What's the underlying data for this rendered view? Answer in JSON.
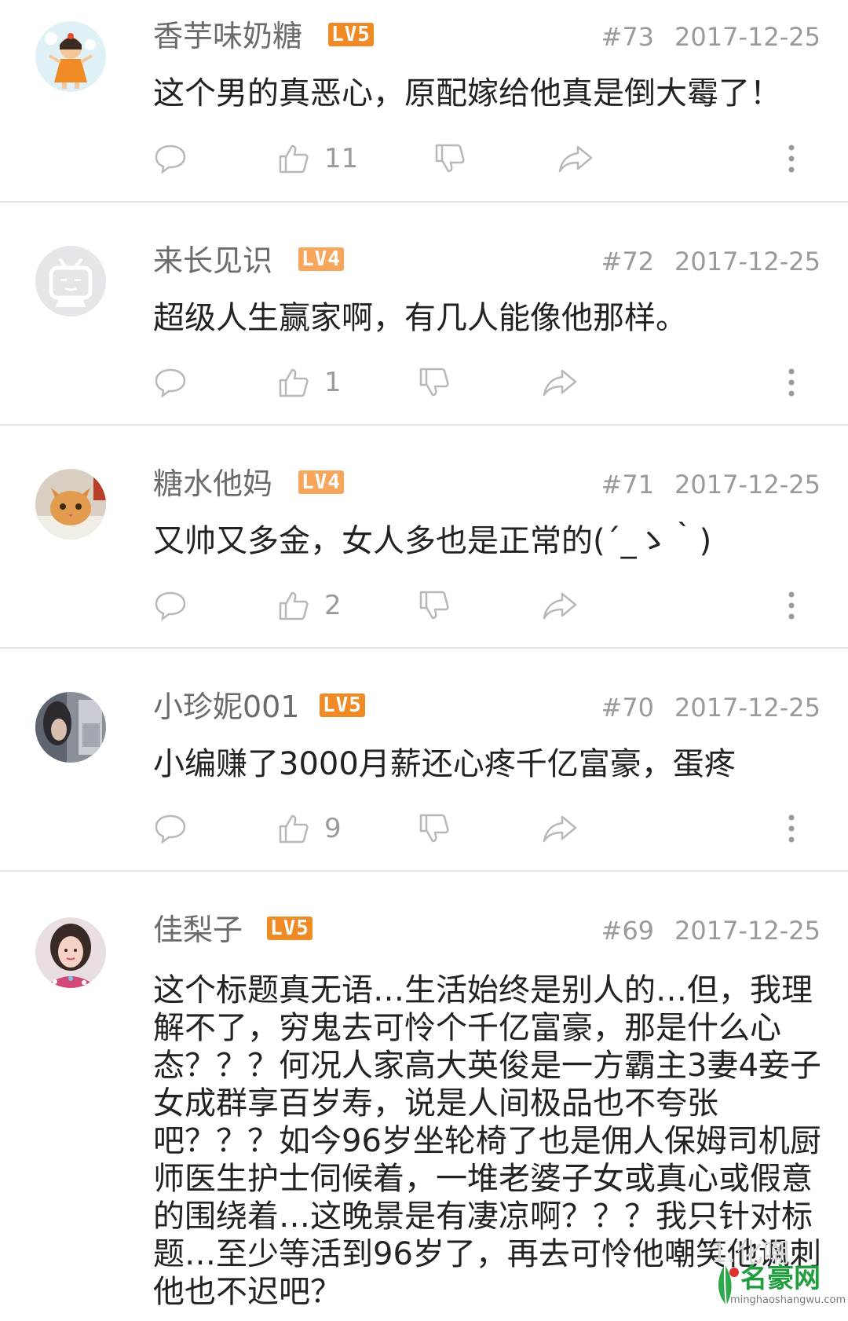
{
  "comments": [
    {
      "user": "香芋味奶糖",
      "level": "LV5",
      "floor": "#73",
      "date": "2017-12-25",
      "text": "这个男的真恶心，原配嫁给他真是倒大霉了！",
      "likes": "11",
      "avatar": "girl-cartoon-avatar"
    },
    {
      "user": "来长见识",
      "level": "LV4",
      "floor": "#72",
      "date": "2017-12-25",
      "text": "超级人生赢家啊，有几人能像他那样。",
      "likes": "1",
      "avatar": "tv-mascot-avatar"
    },
    {
      "user": "糖水他妈",
      "level": "LV4",
      "floor": "#71",
      "date": "2017-12-25",
      "text": "又帅又多金，女人多也是正常的(´_ゝ｀)",
      "likes": "2",
      "avatar": "cat-avatar"
    },
    {
      "user": "小珍妮001",
      "level": "LV5",
      "floor": "#70",
      "date": "2017-12-25",
      "text": "小编赚了3000月薪还心疼千亿富豪，蛋疼",
      "likes": "9",
      "avatar": "photo-avatar"
    },
    {
      "user": "佳梨子",
      "level": "LV5",
      "floor": "#69",
      "date": "2017-12-25",
      "text": "这个标题真无语…生活始终是别人的…但，我理解不了，穷鬼去可怜个千亿富豪，那是什么心态？？？何况人家高大英俊是一方霸主3妻4妾子女成群享百岁寿，说是人间极品也不夸张吧？？？如今96岁坐轮椅了也是佣人保姆司机厨师医生护士伺候着，一堆老婆子女或真心或假意的围绕着…这晚景是有凄凉啊？？？我只针对标题…至少等活到96岁了，再去可怜他嘲笑他讽刺他也不迟吧？",
      "likes": "",
      "avatar": "girl-photo-avatar"
    }
  ],
  "watermark": {
    "title": "名豪网",
    "url": "minghaoshangwu.com",
    "bg_text": "1.化嘲"
  },
  "colors": {
    "level_lv4": "#f7a65b",
    "level_lv5": "#f08a24",
    "text": "#222222",
    "meta": "#9a9a9a",
    "divider": "#e6e6e6"
  }
}
